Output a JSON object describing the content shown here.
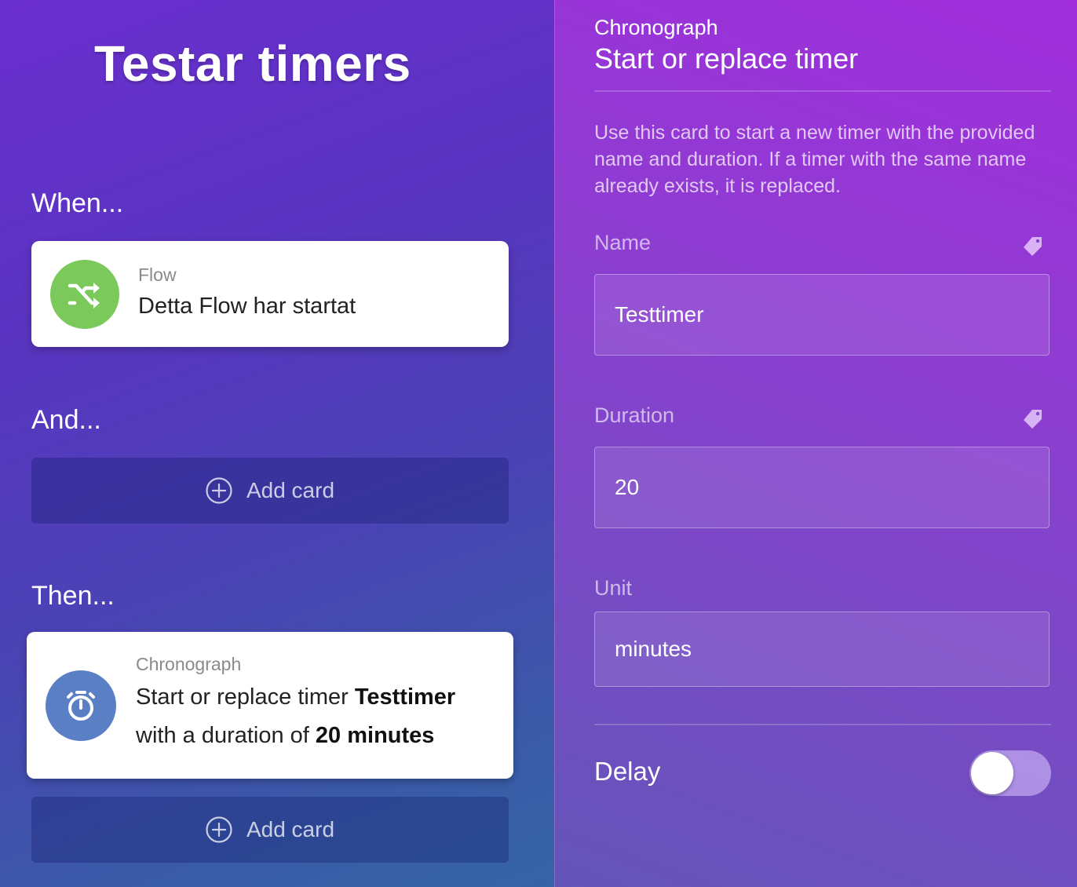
{
  "flow": {
    "title": "Testar timers",
    "when_label": "When...",
    "and_label": "And...",
    "then_label": "Then...",
    "add_card_label": "Add card",
    "when_card": {
      "app": "Flow",
      "text": "Detta Flow har startat",
      "icon": "shuffle-icon",
      "badge_color": "#7ac95a"
    },
    "then_card": {
      "app": "Chronograph",
      "text_prefix": "Start or replace timer ",
      "timer_name": "Testtimer",
      "text_mid": "with a duration of ",
      "duration": "20 minutes",
      "icon": "stopwatch-icon",
      "badge_color": "#5a7fc4"
    }
  },
  "editor": {
    "app": "Chronograph",
    "title": "Start or replace timer",
    "description": "Use this card to start a new timer with the provided name and duration. If a timer with the same name already exists, it is replaced.",
    "name_label": "Name",
    "name_value": "Testtimer",
    "duration_label": "Duration",
    "duration_value": "20",
    "unit_label": "Unit",
    "unit_value": "minutes",
    "delay_label": "Delay",
    "delay_enabled": false
  }
}
